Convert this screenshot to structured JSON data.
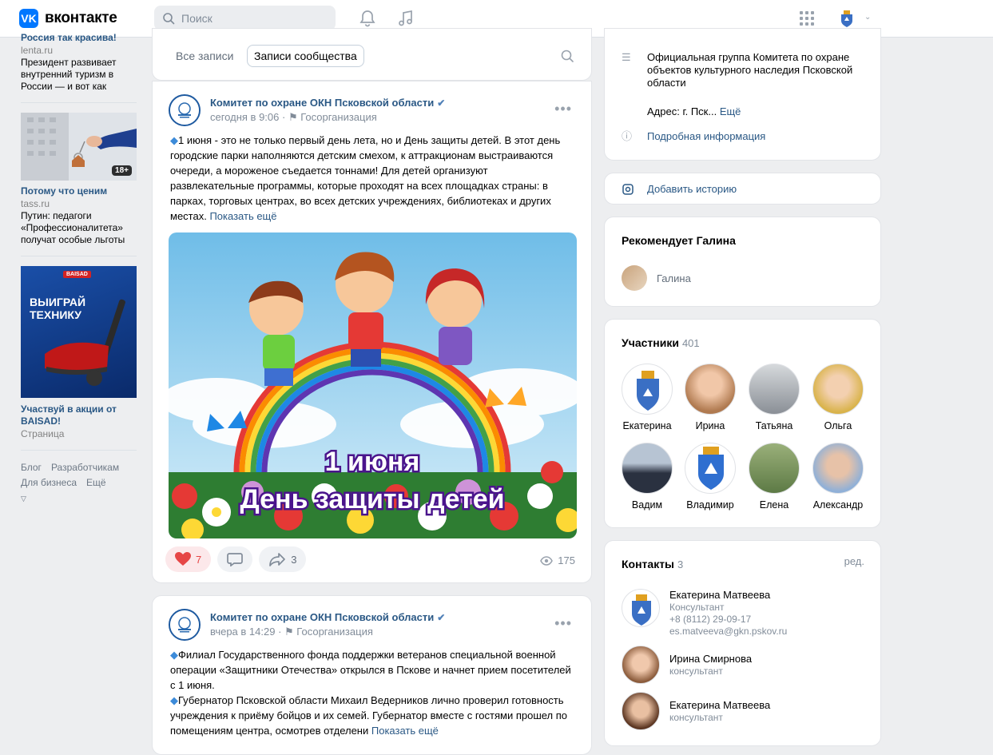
{
  "header": {
    "logo_mark": "VK",
    "logo_text": "вконтакте",
    "search_placeholder": "Поиск",
    "chevron": "⌄"
  },
  "left_ads": [
    {
      "title": "Россия так красива!",
      "source": "lenta.ru",
      "desc": "Президент развивает внутренний туризм в России — и вот как"
    },
    {
      "title": "Потому что ценим",
      "source": "tass.ru",
      "desc": "Путин: педагоги «Профессионалитета» получат особые льготы",
      "badge": "18+"
    },
    {
      "title": "Участвуй в акции от BAISAD!",
      "source": "Страница",
      "image_brand": "BAISAD",
      "image_text_1": "ВЫИГРАЙ",
      "image_text_2": "ТЕХНИКУ"
    }
  ],
  "footer": {
    "links": [
      "Блог",
      "Разработчикам",
      "Для бизнеса",
      "Ещё"
    ]
  },
  "tabs": {
    "all": "Все записи",
    "community": "Записи сообщества"
  },
  "post1": {
    "author": "Комитет по охране ОКН Псковской области",
    "time": "сегодня в 9:06",
    "org": "Госорганизация",
    "text": "1 июня - это не только первый день лета, но и День защиты детей. В этот день городские парки наполняются детским смехом, к аттракционам выстраиваются очереди, а мороженое съедается тоннами! Для детей организуют развлекательные программы, которые проходят на всех площадках страны: в парках, торговых центрах, во всех детских учреждениях, библиотеках и других местах.",
    "more": "Показать ещё",
    "image_line1": "1 июня",
    "image_line2": "День защиты детей",
    "likes": "7",
    "shares": "3",
    "views": "175"
  },
  "post2": {
    "author": "Комитет по охране ОКН Псковской области",
    "time": "вчера в 14:29",
    "org": "Госорганизация",
    "text1": "Филиал Государственного фонда поддержки ветеранов специальной военной операции «Защитники Отечества» открылся в Пскове и начнет прием посетителей с 1 июня.",
    "text2": "Губернатор Псковской области Михаил Ведерников лично проверил готовность учреждения к приёму бойцов и их семей. Губернатор вместе с гостями прошел по помещениям центра, осмотрев отделени",
    "more": "Показать ещё"
  },
  "info": {
    "description": "Официальная группа Комитета по охране объектов культурного наследия Псковской области",
    "address": "Адрес: г. Пск...",
    "address_more": "Ещё",
    "details": "Подробная информация"
  },
  "story": {
    "label": "Добавить историю"
  },
  "recommend": {
    "title": "Рекомендует Галина",
    "name": "Галина"
  },
  "members": {
    "title": "Участники",
    "count": "401",
    "list": [
      "Екатерина",
      "Ирина",
      "Татьяна",
      "Ольга",
      "Вадим",
      "Владимир",
      "Елена",
      "Александр"
    ]
  },
  "contacts": {
    "title": "Контакты",
    "count": "3",
    "edit": "ред.",
    "list": [
      {
        "name": "Екатерина Матвеева",
        "role": "Консультант",
        "phone": "+8 (8112) 29-09-17",
        "email": "es.matveeva@gkn.pskov.ru"
      },
      {
        "name": "Ирина Смирнова",
        "role": "консультант"
      },
      {
        "name": "Екатерина Матвеева",
        "role": "консультант"
      }
    ]
  },
  "colors": {
    "accent": "#2a5885",
    "like": "#e64646",
    "bg": "#edeef0"
  }
}
